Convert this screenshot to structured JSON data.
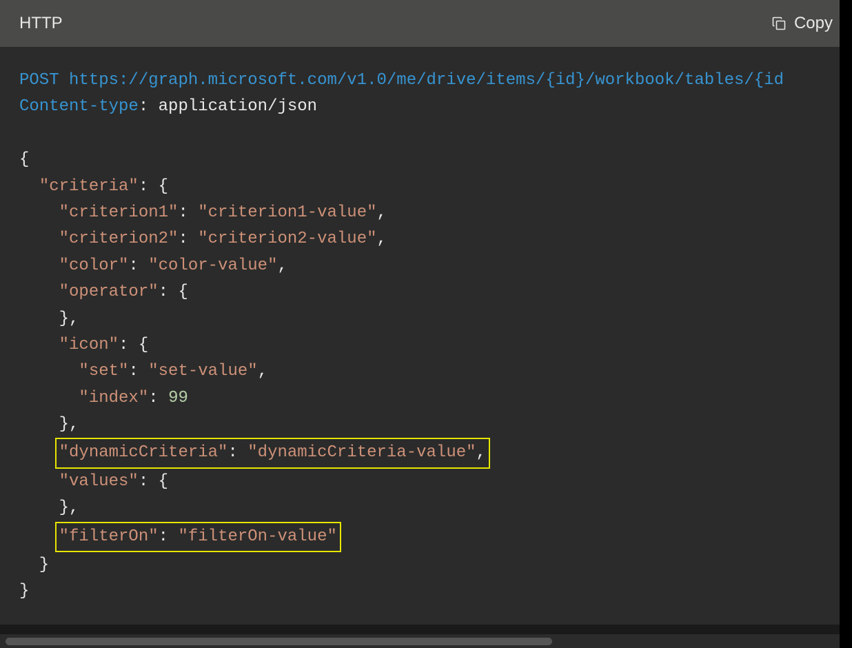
{
  "header": {
    "title": "HTTP",
    "copy_label": "Copy"
  },
  "code": {
    "method": "POST",
    "url": "https://graph.microsoft.com/v1.0/me/drive/items/{id}/workbook/tables/{id",
    "header_key": "Content-type",
    "header_sep": ": ",
    "header_val": "application/json",
    "l1": "{",
    "l2a": "  ",
    "l2b": "\"criteria\"",
    "l2c": ": {",
    "l3a": "    ",
    "l3b": "\"criterion1\"",
    "l3c": ": ",
    "l3d": "\"criterion1-value\"",
    "l3e": ",",
    "l4a": "    ",
    "l4b": "\"criterion2\"",
    "l4c": ": ",
    "l4d": "\"criterion2-value\"",
    "l4e": ",",
    "l5a": "    ",
    "l5b": "\"color\"",
    "l5c": ": ",
    "l5d": "\"color-value\"",
    "l5e": ",",
    "l6a": "    ",
    "l6b": "\"operator\"",
    "l6c": ": {",
    "l7": "    },",
    "l8a": "    ",
    "l8b": "\"icon\"",
    "l8c": ": {",
    "l9a": "      ",
    "l9b": "\"set\"",
    "l9c": ": ",
    "l9d": "\"set-value\"",
    "l9e": ",",
    "l10a": "      ",
    "l10b": "\"index\"",
    "l10c": ": ",
    "l10d": "99",
    "l11": "    },",
    "l12a": "\"dynamicCriteria\"",
    "l12b": ": ",
    "l12c": "\"dynamicCriteria-value\"",
    "l12d": ",",
    "l13a": "    ",
    "l13b": "\"values\"",
    "l13c": ": {",
    "l14": "    },",
    "l15a": "\"filterOn\"",
    "l15b": ": ",
    "l15c": "\"filterOn-value\"",
    "l16": "  }",
    "l17": "}",
    "indent4": "    "
  }
}
